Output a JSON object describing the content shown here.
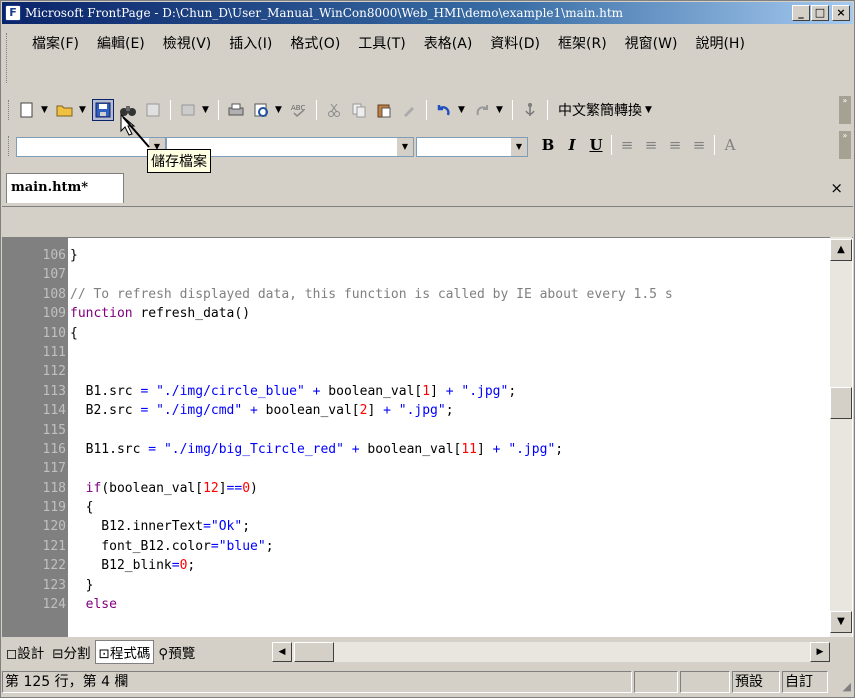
{
  "window": {
    "title": "Microsoft FrontPage - D:\\Chun_D\\User_Manual_WinCon8000\\Web_HMI\\demo\\example1\\main.htm",
    "app_icon": "frontpage-icon"
  },
  "title_buttons": {
    "minimize": "_",
    "maximize": "□",
    "close": "×"
  },
  "menu": [
    "檔案(F)",
    "編輯(E)",
    "檢視(V)",
    "插入(I)",
    "格式(O)",
    "工具(T)",
    "表格(A)",
    "資料(D)",
    "框架(R)",
    "視窗(W)",
    "說明(H)"
  ],
  "toolbar": {
    "chinese_convert": "中文繁簡轉換",
    "tooltip": "儲存檔案"
  },
  "format_toolbar": {
    "bold": "B",
    "italic": "I",
    "underline": "U",
    "font_grow": "A"
  },
  "document_tab": {
    "name": "main.htm*",
    "close": "×"
  },
  "code_lines": [
    {
      "n": "106",
      "t": "}"
    },
    {
      "n": "107",
      "t": ""
    },
    {
      "n": "108",
      "t": "// To refresh displayed data, this function is called by IE about every 1.5 s"
    },
    {
      "n": "109",
      "t": "function refresh_data()"
    },
    {
      "n": "110",
      "t": "{"
    },
    {
      "n": "111",
      "t": ""
    },
    {
      "n": "112",
      "t": ""
    },
    {
      "n": "113",
      "t": "  B1.src = \"./img/circle_blue\" + boolean_val[1] + \".jpg\";"
    },
    {
      "n": "114",
      "t": "  B2.src = \"./img/cmd\" + boolean_val[2] + \".jpg\";"
    },
    {
      "n": "115",
      "t": ""
    },
    {
      "n": "116",
      "t": "  B11.src = \"./img/big_Tcircle_red\" + boolean_val[11] + \".jpg\";"
    },
    {
      "n": "117",
      "t": ""
    },
    {
      "n": "118",
      "t": "  if(boolean_val[12]==0)"
    },
    {
      "n": "119",
      "t": "  {"
    },
    {
      "n": "120",
      "t": "    B12.innerText=\"Ok\";"
    },
    {
      "n": "121",
      "t": "    font_B12.color=\"blue\";"
    },
    {
      "n": "122",
      "t": "    B12_blink=0;"
    },
    {
      "n": "123",
      "t": "  }"
    },
    {
      "n": "124",
      "t": "  else"
    }
  ],
  "view_tabs": [
    "設計",
    "分割",
    "程式碼",
    "預覽"
  ],
  "status": {
    "position": "第 125 行，第 4 欄",
    "mode": "預設",
    "custom": "自訂"
  }
}
